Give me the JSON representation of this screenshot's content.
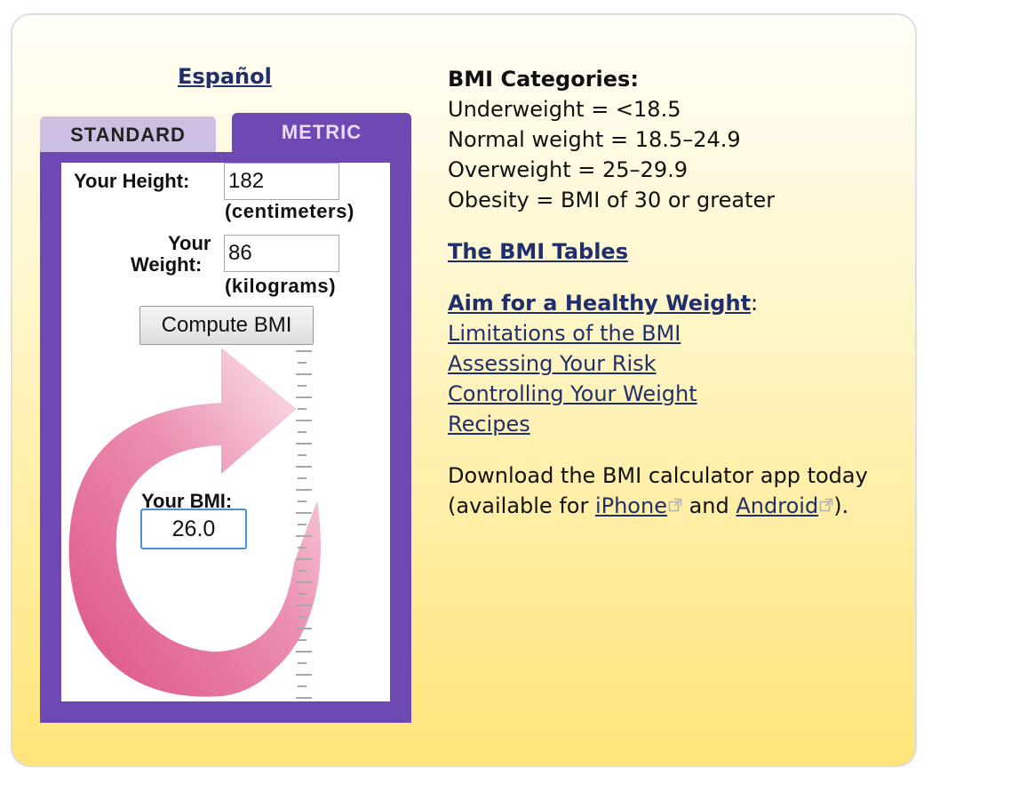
{
  "calculator": {
    "language_link": "Español",
    "tabs": [
      {
        "label": "STANDARD",
        "selected": false
      },
      {
        "label": "METRIC",
        "selected": true
      }
    ],
    "height": {
      "label": "Your Height:",
      "value": "182",
      "unit": "(centimeters)"
    },
    "weight": {
      "label_line1": "Your",
      "label_line2": "Weight:",
      "value": "86",
      "unit": "(kilograms)"
    },
    "compute_button": "Compute BMI",
    "result": {
      "label": "Your BMI:",
      "value": "26.0"
    },
    "colors": {
      "frame": "#6f49b3",
      "tab_inactive": "#cdbfe3",
      "arrow": "#e0608e",
      "link": "#1f2f6b"
    }
  },
  "info": {
    "categories_title": "BMI Categories:",
    "categories": [
      "Underweight = <18.5",
      "Normal weight = 18.5–24.9",
      "Overweight = 25–29.9",
      "Obesity = BMI of 30 or greater"
    ],
    "bmi_tables_link": "The BMI Tables",
    "healthy_weight_link": "Aim for a Healthy Weight",
    "healthy_weight_colon": ":",
    "sub_links": [
      "Limitations of the BMI",
      "Assessing Your Risk",
      "Controlling Your Weight",
      "Recipes"
    ],
    "download_line1": "Download the BMI calculator app today",
    "download_prefix": "(available for ",
    "iphone_link": "iPhone",
    "download_and": " and ",
    "android_link": "Android",
    "download_suffix": ")."
  }
}
